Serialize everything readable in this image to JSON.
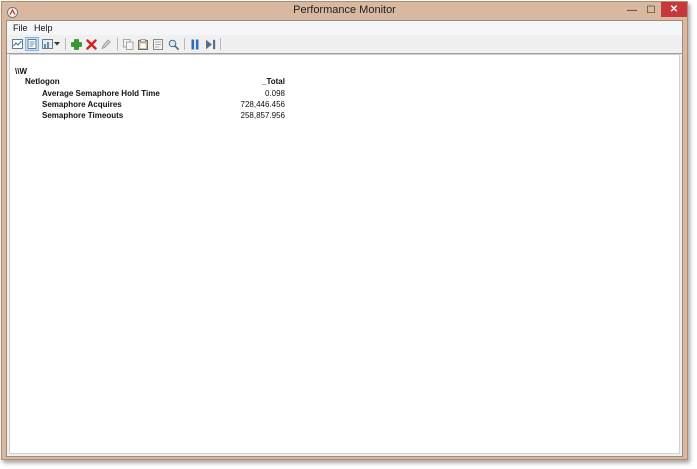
{
  "window": {
    "title": "Performance Monitor",
    "minimize_glyph": "—",
    "maximize_glyph": "☐",
    "close_glyph": "✕"
  },
  "menu": {
    "items": [
      {
        "label": "File"
      },
      {
        "label": "Help"
      }
    ]
  },
  "toolbar": {
    "buttons": [
      {
        "icon": "view-graph-icon"
      },
      {
        "icon": "view-report-icon",
        "active": true
      },
      {
        "icon": "change-graph-type-icon"
      },
      {
        "icon": "add-counter-icon",
        "color": "#2e9e2e"
      },
      {
        "icon": "delete-counter-icon",
        "color": "#d42020"
      },
      {
        "icon": "highlight-icon"
      },
      {
        "icon": "copy-properties-icon"
      },
      {
        "icon": "paste-counter-list-icon"
      },
      {
        "icon": "properties-icon"
      },
      {
        "icon": "zoom-icon"
      },
      {
        "icon": "freeze-display-icon",
        "color": "#2b6fb8"
      },
      {
        "icon": "update-data-icon"
      }
    ]
  },
  "report": {
    "computer": "\\\\W",
    "object": "Netlogon",
    "instance": "_Total",
    "counters": [
      {
        "name": "Average Semaphore Hold Time",
        "value": "0.098"
      },
      {
        "name": "Semaphore Acquires",
        "value": "728,446.456"
      },
      {
        "name": "Semaphore Timeouts",
        "value": "258,857.956"
      }
    ]
  },
  "colors": {
    "frame": "#d9b8a0",
    "close_button": "#c7383a"
  }
}
